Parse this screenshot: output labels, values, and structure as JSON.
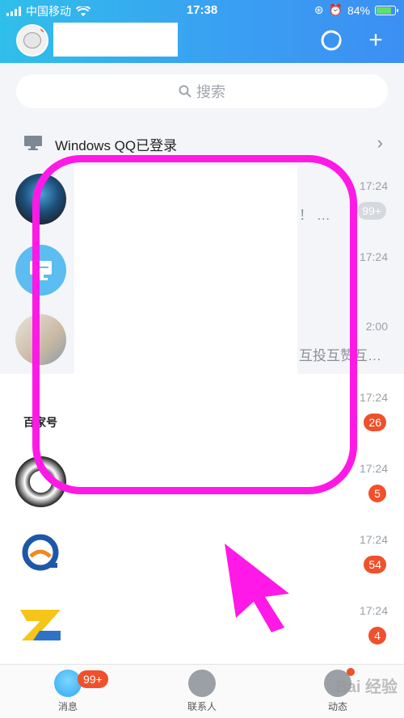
{
  "status_bar": {
    "carrier": "中国移动",
    "time": "17:38",
    "battery_percent": "84%",
    "battery_level": 0.84
  },
  "header": {
    "avatar_icon": "user-avatar-icon",
    "right_icons": [
      "circle-icon",
      "plus-icon"
    ]
  },
  "search": {
    "placeholder": "搜索"
  },
  "login_notice": {
    "text": "Windows QQ已登录"
  },
  "chats": [
    {
      "time": "17:24",
      "snippet": "！ …",
      "badge": "99+",
      "badge_style": "gray"
    },
    {
      "time": "17:24",
      "snippet": "",
      "badge": ""
    },
    {
      "time": "2:00",
      "snippet": "互投互赞互…",
      "badge": ""
    },
    {
      "time": "17:24",
      "snippet": "",
      "badge": "26"
    },
    {
      "time": "17:24",
      "snippet": "",
      "badge": "5"
    },
    {
      "time": "17:24",
      "snippet": "",
      "badge": "54"
    },
    {
      "time": "17:24",
      "snippet": "",
      "badge": "4"
    }
  ],
  "avatar_texts": {
    "baijiahao": "百家号"
  },
  "tabs": [
    {
      "label": "消息",
      "badge": "99+"
    },
    {
      "label": "联系人"
    },
    {
      "label": "动态"
    }
  ],
  "watermark": "Bai 经验",
  "colors": {
    "accent": "#3aa0f2",
    "badge": "#f0502c",
    "annotation": "#ff19e6"
  }
}
